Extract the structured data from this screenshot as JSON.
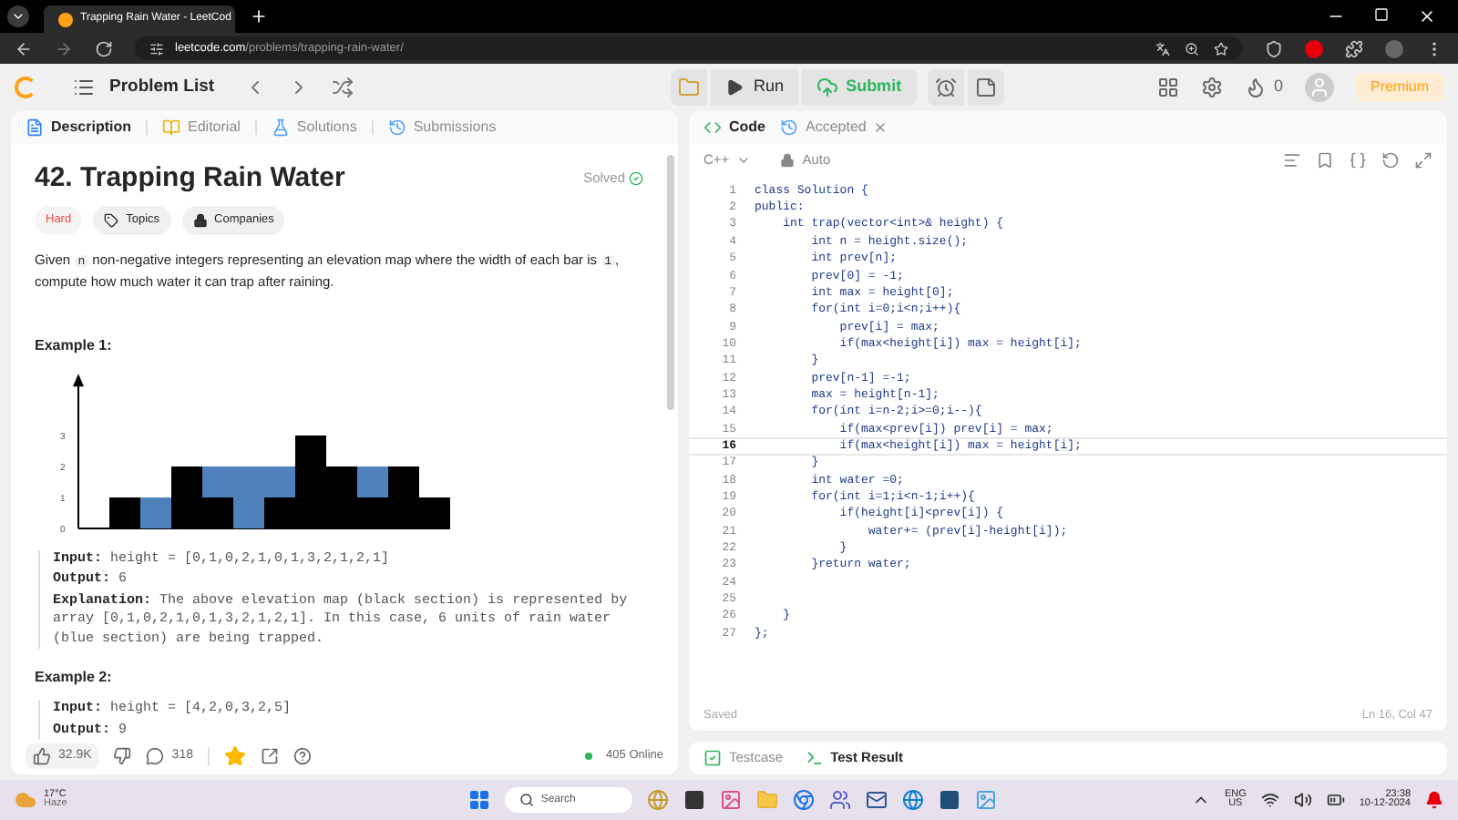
{
  "browser": {
    "tab_title": "Trapping Rain Water - LeetCod",
    "url_domain": "leetcode.com",
    "url_path": "/problems/trapping-rain-water/"
  },
  "nav": {
    "problem_list": "Problem List",
    "run": "Run",
    "submit": "Submit",
    "streak": "0",
    "premium": "Premium"
  },
  "left_tabs": [
    {
      "label": "Description",
      "selected": true
    },
    {
      "label": "Editorial",
      "selected": false
    },
    {
      "label": "Solutions",
      "selected": false
    },
    {
      "label": "Submissions",
      "selected": false
    }
  ],
  "problem": {
    "title": "42. Trapping Rain Water",
    "status": "Solved",
    "difficulty": "Hard",
    "tags": [
      "Topics",
      "Companies"
    ],
    "description": [
      {
        "kind": "text",
        "text": "Given "
      },
      {
        "kind": "code",
        "text": "n"
      },
      {
        "kind": "text",
        "text": " non-negative integers representing an elevation map where the width of each bar is "
      },
      {
        "kind": "code",
        "text": "1"
      },
      {
        "kind": "text",
        "text": ", compute how much water it can trap after raining."
      }
    ]
  },
  "examples": [
    {
      "heading": "Example 1:",
      "chart_data": {
        "type": "bar",
        "stacked": true,
        "yticks": [
          0,
          1,
          2,
          3
        ],
        "ylim": [
          0,
          4.7
        ],
        "series": [
          {
            "color": "#000000",
            "values": [
              0,
              1,
              0,
              2,
              1,
              0,
              1,
              3,
              2,
              1,
              2,
              1
            ]
          },
          {
            "color": "#4f81bd",
            "values": [
              0,
              0,
              1,
              0,
              1,
              2,
              1,
              0,
              0,
              1,
              0,
              0
            ]
          }
        ]
      },
      "lines": [
        {
          "label": "Input:",
          "text": "height = [0,1,0,2,1,0,1,3,2,1,2,1]"
        },
        {
          "label": "Output:",
          "text": "6"
        },
        {
          "label": "Explanation:",
          "text": "The above elevation map (black section) is represented by array [0,1,0,2,1,0,1,3,2,1,2,1]. In this case, 6 units of rain water (blue section) are being trapped."
        }
      ]
    },
    {
      "heading": "Example 2:",
      "lines": [
        {
          "label": "Input:",
          "text": "height = [4,2,0,3,2,5]"
        },
        {
          "label": "Output:",
          "text": "9"
        }
      ]
    }
  ],
  "footer": {
    "likes": "32.9K",
    "comments": "318",
    "starred": true,
    "online": "405 Online"
  },
  "editor": {
    "tabs": [
      {
        "label": "Code",
        "selected": true
      },
      {
        "label": "Accepted",
        "selected": false
      }
    ],
    "language": "C++",
    "mode": "Auto",
    "lines": [
      {
        "number": "1",
        "code": "class Solution {",
        "current": false
      },
      {
        "number": "2",
        "code": "public:",
        "current": false
      },
      {
        "number": "3",
        "code": "    int trap(vector<int>& height) {",
        "current": false
      },
      {
        "number": "4",
        "code": "        int n = height.size();",
        "current": false
      },
      {
        "number": "5",
        "code": "        int prev[n];",
        "current": false
      },
      {
        "number": "6",
        "code": "        prev[0] = -1;",
        "current": false
      },
      {
        "number": "7",
        "code": "        int max = height[0];",
        "current": false
      },
      {
        "number": "8",
        "code": "        for(int i=0;i<n;i++){",
        "current": false
      },
      {
        "number": "9",
        "code": "            prev[i] = max;",
        "current": false
      },
      {
        "number": "10",
        "code": "            if(max<height[i]) max = height[i];",
        "current": false
      },
      {
        "number": "11",
        "code": "        }",
        "current": false
      },
      {
        "number": "12",
        "code": "        prev[n-1] =-1;",
        "current": false
      },
      {
        "number": "13",
        "code": "        max = height[n-1];",
        "current": false
      },
      {
        "number": "14",
        "code": "        for(int i=n-2;i>=0;i--){",
        "current": false
      },
      {
        "number": "15",
        "code": "            if(max<prev[i]) prev[i] = max;",
        "current": false
      },
      {
        "number": "16",
        "code": "            if(max<height[i]) max = height[i];",
        "current": true
      },
      {
        "number": "17",
        "code": "        }",
        "current": false
      },
      {
        "number": "18",
        "code": "        int water =0;",
        "current": false
      },
      {
        "number": "19",
        "code": "        for(int i=1;i<n-1;i++){",
        "current": false
      },
      {
        "number": "20",
        "code": "            if(height[i]<prev[i]) {",
        "current": false
      },
      {
        "number": "21",
        "code": "                water+= (prev[i]-height[i]);",
        "current": false
      },
      {
        "number": "22",
        "code": "            }",
        "current": false
      },
      {
        "number": "23",
        "code": "        }return water;",
        "current": false
      },
      {
        "number": "24",
        "current": false
      },
      {
        "number": "25",
        "current": false
      },
      {
        "number": "26",
        "code": "    }",
        "current": false
      },
      {
        "number": "27",
        "code": "};",
        "current": false
      }
    ],
    "status": "Saved",
    "cursor": "Ln 16, Col 47"
  },
  "console_tabs": [
    {
      "label": "Testcase",
      "selected": false
    },
    {
      "label": "Test Result",
      "selected": true
    }
  ],
  "taskbar": {
    "temperature": "17°C",
    "weather": "Haze",
    "search": "Search",
    "language": "ENG",
    "region": "US",
    "time": "23:38",
    "date": "10-12-2024"
  }
}
